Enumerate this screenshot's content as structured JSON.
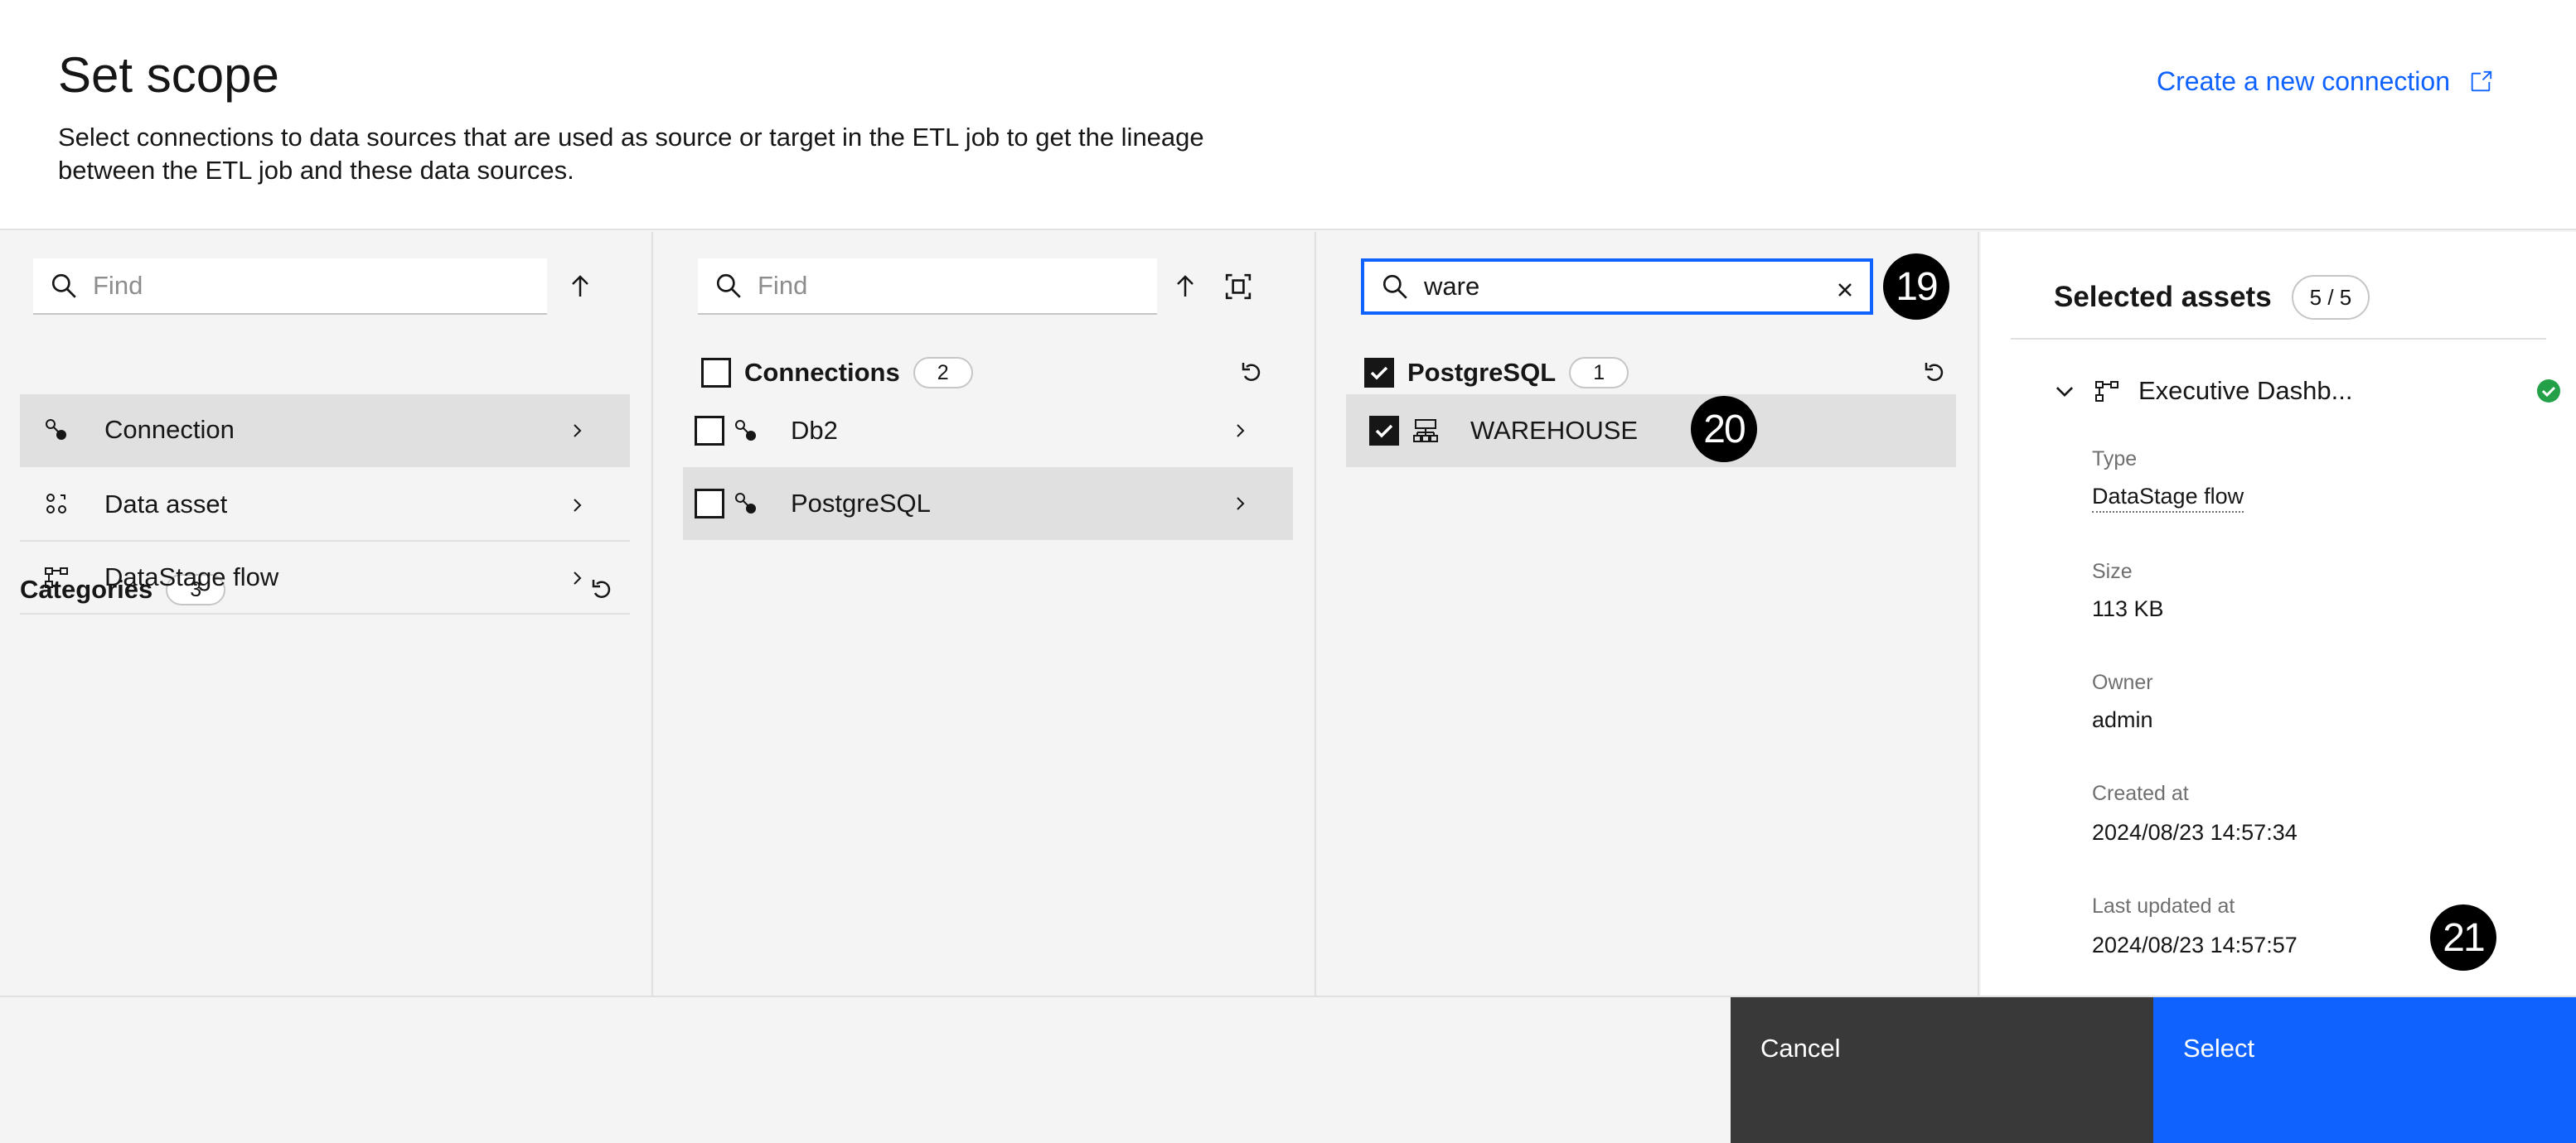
{
  "header": {
    "title": "Set scope",
    "description": "Select connections to data sources that are used as source or target in the ETL job to get the lineage between the ETL job and these data sources.",
    "create_link": "Create a new connection"
  },
  "col1": {
    "search_placeholder": "Find",
    "section_label": "Categories",
    "count": "3",
    "items": [
      {
        "label": "Connection",
        "icon": "connection-icon"
      },
      {
        "label": "Data asset",
        "icon": "data-asset-icon"
      },
      {
        "label": "DataStage flow",
        "icon": "flow-icon"
      }
    ]
  },
  "col2": {
    "search_placeholder": "Find",
    "section_label": "Connections",
    "count": "2",
    "items": [
      {
        "label": "Db2",
        "checked": false
      },
      {
        "label": "PostgreSQL",
        "checked": false
      }
    ]
  },
  "col3": {
    "search_value": "ware",
    "section_label": "PostgreSQL",
    "count": "1",
    "items": [
      {
        "label": "WAREHOUSE",
        "checked": true
      }
    ]
  },
  "badges": {
    "b19": "19",
    "b20": "20",
    "b21": "21"
  },
  "selected_assets": {
    "title": "Selected assets",
    "count": "5 / 5",
    "asset": {
      "name": "Executive Dashb...",
      "status": "success",
      "props": {
        "type_label": "Type",
        "type_value": "DataStage flow",
        "size_label": "Size",
        "size_value": "113 KB",
        "owner_label": "Owner",
        "owner_value": "admin",
        "created_label": "Created at",
        "created_value": "2024/08/23 14:57:34",
        "updated_label": "Last updated at",
        "updated_value": "2024/08/23 14:57:57"
      }
    }
  },
  "footer": {
    "cancel": "Cancel",
    "select": "Select"
  },
  "colors": {
    "accent": "#0f62fe",
    "success": "#24a148",
    "cancel_bg": "#393939"
  }
}
